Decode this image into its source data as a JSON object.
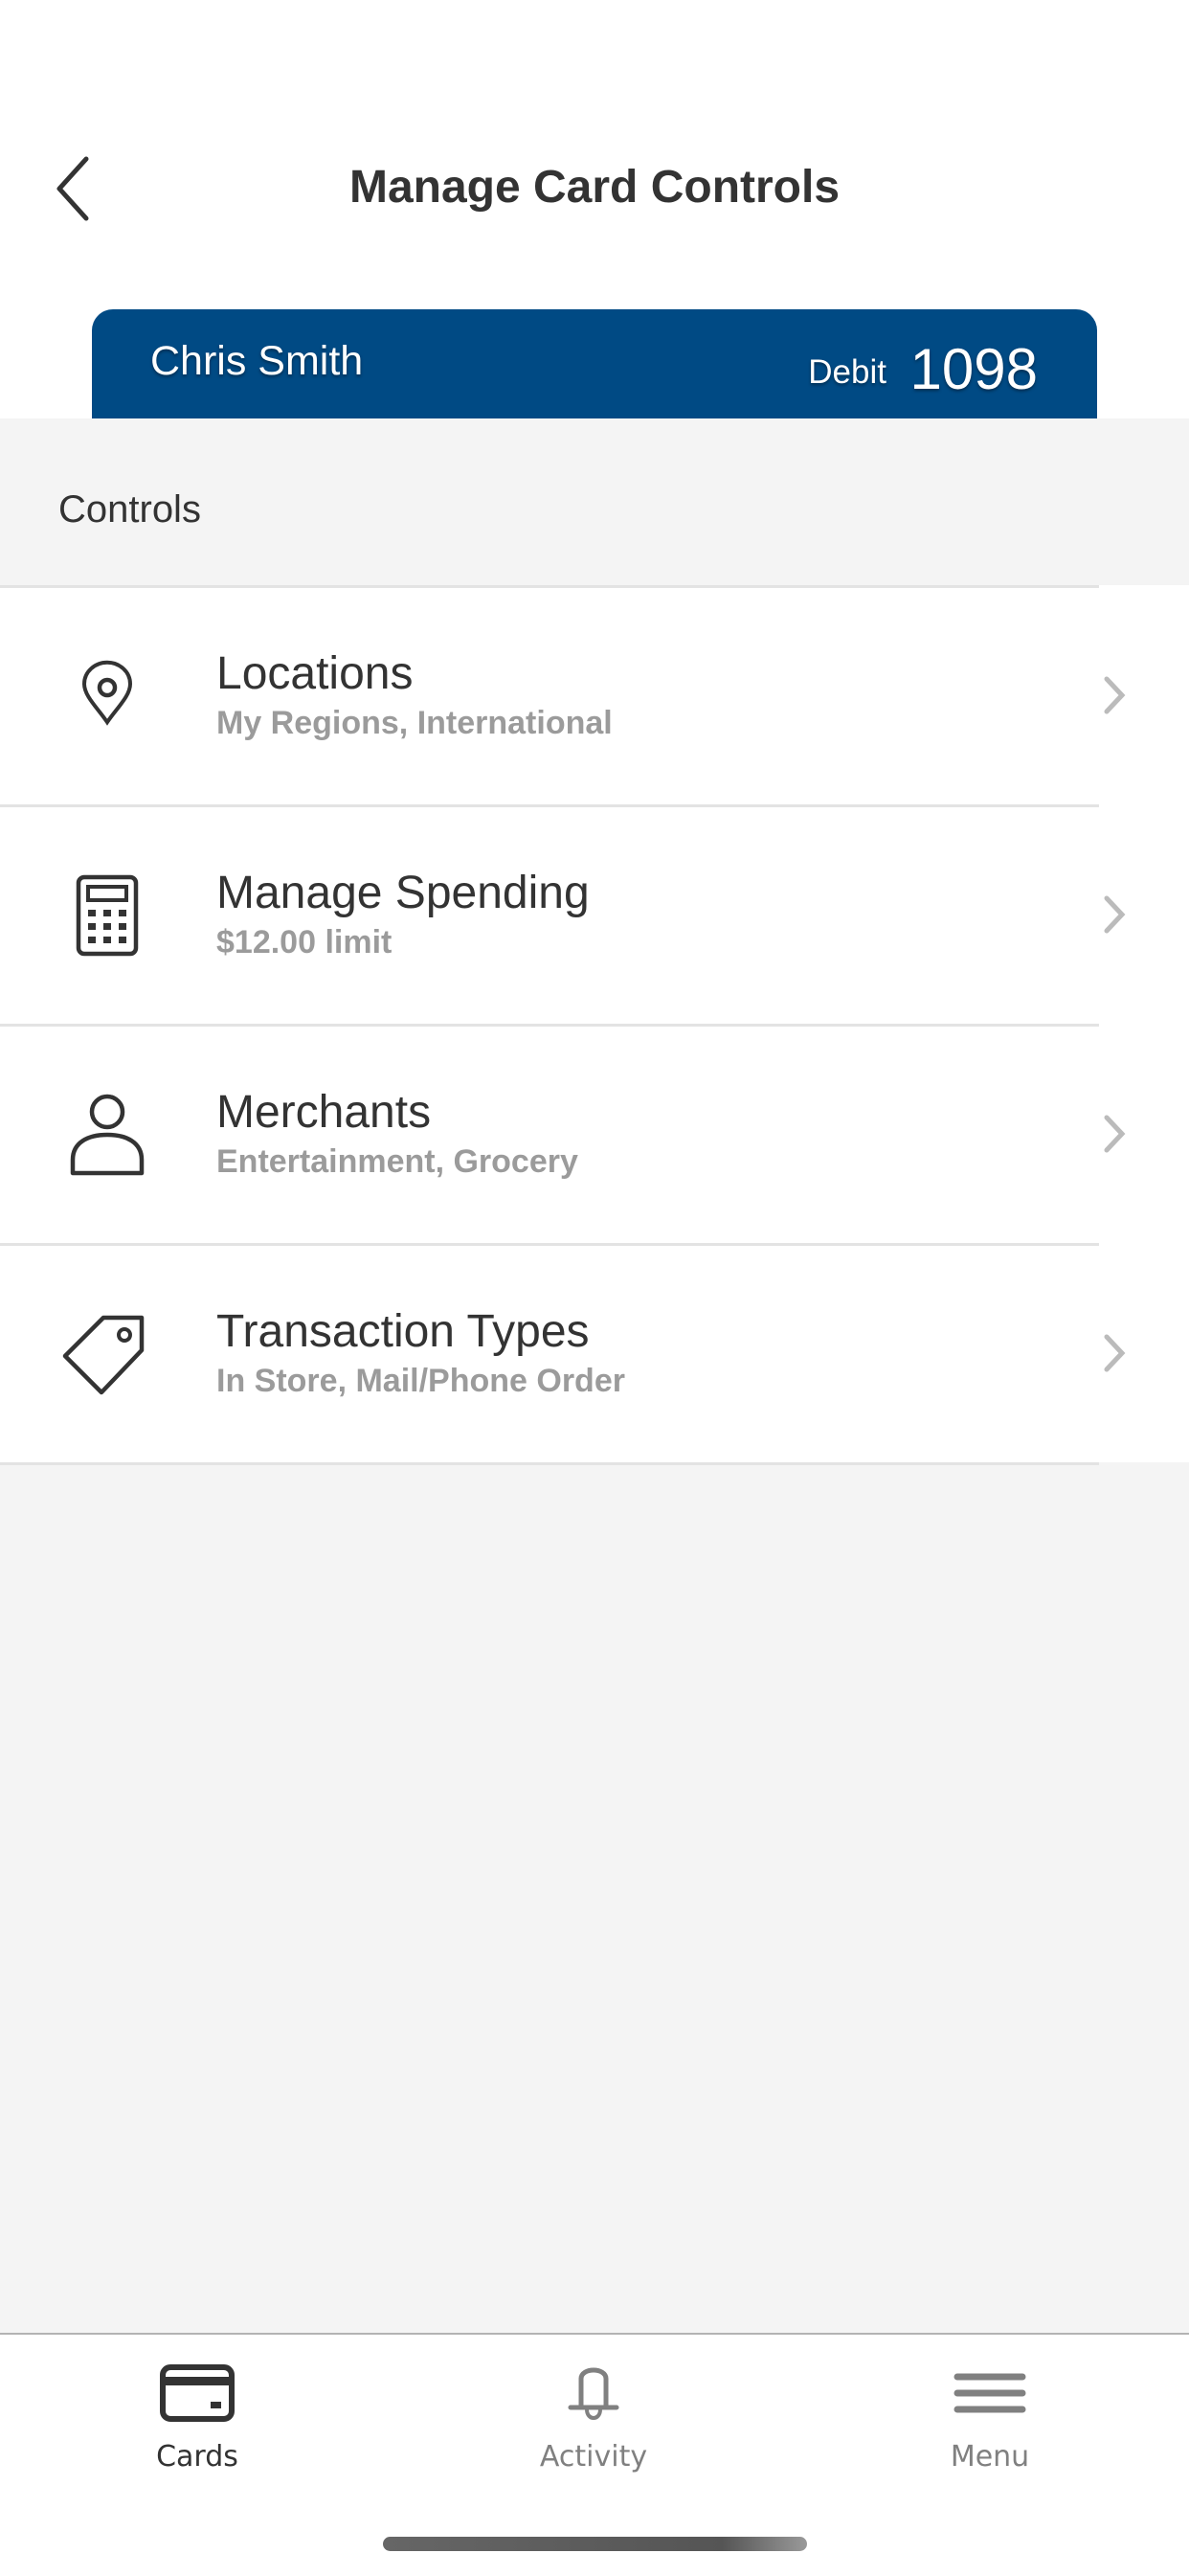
{
  "header": {
    "title": "Manage Card Controls",
    "back_icon": "chevron-left-icon"
  },
  "card": {
    "holder": "Chris Smith",
    "type": "Debit",
    "last4": "1098",
    "color": "#004a84"
  },
  "section_title": "Controls",
  "controls": [
    {
      "title": "Locations",
      "subtitle": "My Regions, International",
      "icon": "location-pin-icon"
    },
    {
      "title": "Manage Spending",
      "subtitle": "$12.00 limit",
      "icon": "calculator-icon"
    },
    {
      "title": "Merchants",
      "subtitle": "Entertainment, Grocery",
      "icon": "person-icon"
    },
    {
      "title": "Transaction Types",
      "subtitle": "In Store, Mail/Phone Order",
      "icon": "tag-icon"
    }
  ],
  "nav": [
    {
      "label": "Cards",
      "icon": "card-icon",
      "active": true
    },
    {
      "label": "Activity",
      "icon": "bell-icon",
      "active": false
    },
    {
      "label": "Menu",
      "icon": "menu-icon",
      "active": false
    }
  ]
}
